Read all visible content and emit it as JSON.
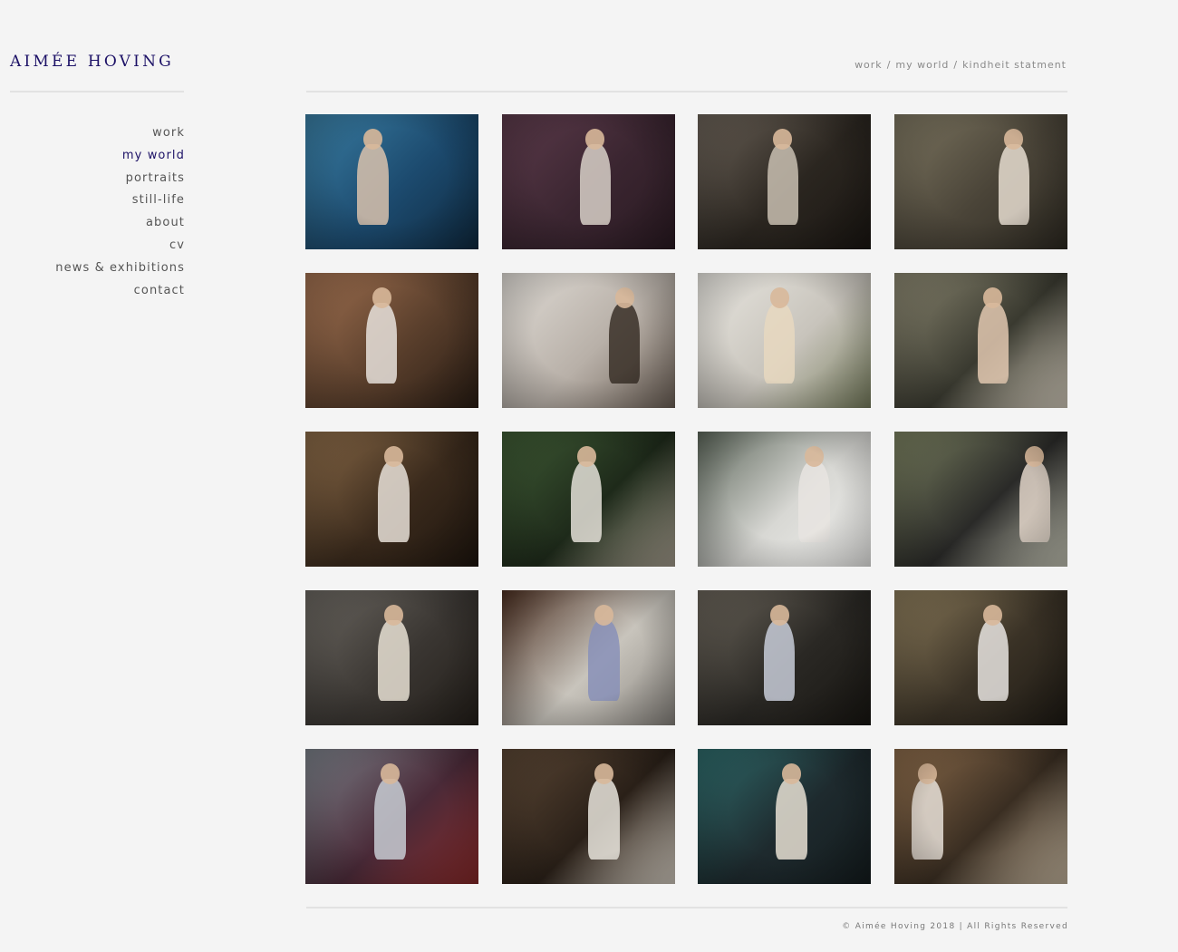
{
  "site": {
    "logo": "AIMÉE HOVING",
    "accent_color": "#1c1166"
  },
  "nav": {
    "items": [
      {
        "label": "work",
        "active": false
      },
      {
        "label": "my world",
        "active": true
      },
      {
        "label": "portraits",
        "active": false
      },
      {
        "label": "still-life",
        "active": false
      },
      {
        "label": "about",
        "active": false
      },
      {
        "label": "cv",
        "active": false
      },
      {
        "label": "news & exhibitions",
        "active": false
      },
      {
        "label": "contact",
        "active": false
      }
    ]
  },
  "breadcrumb": {
    "items": [
      "work",
      "my world",
      "kindheit statment"
    ],
    "separator": "/"
  },
  "gallery": {
    "photos": [
      {
        "subject": "girl in swimming pool",
        "colors": [
          "#1c4a6e",
          "#3a7ea3",
          "#0f2a40"
        ],
        "figure": "#d9c2ad"
      },
      {
        "subject": "girl with flower crown on floral wallpaper",
        "colors": [
          "#3a2530",
          "#5b3a4a",
          "#2a1a22"
        ],
        "figure": "#d8d0c8"
      },
      {
        "subject": "girl leaning on chair by window",
        "colors": [
          "#2b2620",
          "#6b6258",
          "#1a1612"
        ],
        "figure": "#c9bfb2"
      },
      {
        "subject": "girl seated under seascape painting",
        "colors": [
          "#4a4438",
          "#7c7560",
          "#2e2a22"
        ],
        "figure": "#e6ddd0"
      },
      {
        "subject": "girl asleep in armchair with teddy bear",
        "colors": [
          "#5a3f2c",
          "#a07050",
          "#2a1d14"
        ],
        "figure": "#e8e2dc"
      },
      {
        "subject": "plant and sheer curtains",
        "colors": [
          "#b8b0a8",
          "#e0dcd6",
          "#6e6258"
        ],
        "figure": "#3a3028"
      },
      {
        "subject": "girl resting on white sofa",
        "colors": [
          "#c8c4bc",
          "#e8e6e0",
          "#7a8060"
        ],
        "figure": "#e8d8c0"
      },
      {
        "subject": "girl sitting beside dog",
        "colors": [
          "#3a3a30",
          "#8a8670",
          "#d8d0c0"
        ],
        "figure": "#e2c8b0"
      },
      {
        "subject": "girl sitting on wooden floor with flowers",
        "colors": [
          "#3a2a1c",
          "#8a6a48",
          "#1e150e"
        ],
        "figure": "#e8e0d8"
      },
      {
        "subject": "girl among green plants",
        "colors": [
          "#1e2a1a",
          "#3e5a34",
          "#a8a090"
        ],
        "figure": "#e4e0d8"
      },
      {
        "subject": "girl behind glass door",
        "colors": [
          "#d8d8d4",
          "#5a6458",
          "#f0f0ee"
        ],
        "figure": "#e8e4e0"
      },
      {
        "subject": "girl at open doorway",
        "colors": [
          "#2a2a28",
          "#7a8060",
          "#c8c8b8"
        ],
        "figure": "#e0d4c8"
      },
      {
        "subject": "girl seated by stone wall",
        "colors": [
          "#3a3632",
          "#6a6660",
          "#241f1a"
        ],
        "figure": "#e8e0d4"
      },
      {
        "subject": "girl lying on wooden table",
        "colors": [
          "#c8c4bc",
          "#4a2e20",
          "#8a8680"
        ],
        "figure": "#8890b8"
      },
      {
        "subject": "girl standing in empty room",
        "colors": [
          "#2a2824",
          "#6a645a",
          "#181612"
        ],
        "figure": "#c8ccd8"
      },
      {
        "subject": "girl leaning against wallpaper by curtains",
        "colors": [
          "#3a3226",
          "#8a7a5a",
          "#1e1a14"
        ],
        "figure": "#e8e4e0"
      },
      {
        "subject": "girl on floor by grey sofa",
        "colors": [
          "#4a2a38",
          "#7a8088",
          "#8a2a2a"
        ],
        "figure": "#c8ccd4"
      },
      {
        "subject": "girl seated on bed",
        "colors": [
          "#2a2018",
          "#5a4634",
          "#d8d0c4"
        ],
        "figure": "#e8e4dc"
      },
      {
        "subject": "girl curled in teal armchair",
        "colors": [
          "#1e2a2e",
          "#2e6a6a",
          "#141c1e"
        ],
        "figure": "#e8e0d4"
      },
      {
        "subject": "girl beside wooden wardrobe",
        "colors": [
          "#3a2e22",
          "#8a6a4a",
          "#c8b8a0"
        ],
        "figure": "#e8e0d8"
      }
    ]
  },
  "footer": {
    "copyright": "© Aimée Hoving 2018 | All Rights Reserved"
  }
}
